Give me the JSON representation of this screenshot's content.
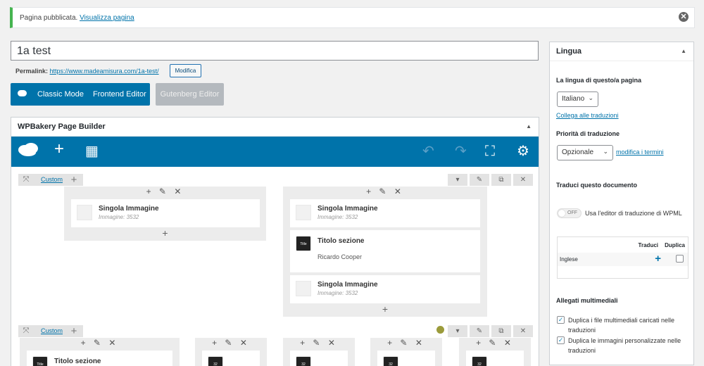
{
  "notice": {
    "text": "Pagina pubblicata.",
    "link": "Visualizza pagina",
    "close_glyph": "✕"
  },
  "title_value": "1a test",
  "permalink": {
    "label": "Permalink:",
    "url": "https://www.madeamisura.com/1a-test/",
    "edit": "Modifica"
  },
  "mode_buttons": {
    "classic": "Classic Mode",
    "frontend": "Frontend Editor",
    "gutenberg": "Gutenberg Editor"
  },
  "wpbakery": {
    "title": "WPBakery Page Builder",
    "toolbar": {
      "add": "+",
      "templates": "▦",
      "undo": "↶",
      "redo": "↷",
      "fullscreen": "⛶",
      "settings": "⚙"
    }
  },
  "builder": {
    "custom_label": "Custom",
    "col_controls": "+ ✎ ✕",
    "row1": {
      "col1": [
        {
          "name": "Singola Immagine",
          "sub": "Immagine: 3532"
        }
      ],
      "col2": [
        {
          "name": "Singola Immagine",
          "sub": "Immagine: 3532"
        },
        {
          "name": "Titolo sezione",
          "sub": "Ricardo Cooper",
          "thumb": "Title"
        },
        {
          "name": "Singola Immagine",
          "sub": "Immagine: 3532"
        }
      ]
    },
    "row2": {
      "col1_el": {
        "name": "Titolo sezione",
        "thumb": "Title"
      },
      "counter_thumb": "32"
    }
  },
  "sidebar": {
    "title": "Lingua",
    "lang_label": "La lingua di questo/a pagina",
    "lang_value": "Italiano",
    "connect_link": "Collega alle traduzioni",
    "priority_label": "Priorità di traduzione",
    "priority_value": "Opzionale",
    "priority_link": "modifica i termini",
    "translate_label": "Traduci questo documento",
    "toggle_off": "OFF",
    "toggle_text": "Usa l'editor di traduzione di WPML",
    "table": {
      "col_translate": "Traduci",
      "col_duplicate": "Duplica",
      "lang": "Inglese",
      "plus": "+"
    },
    "media_label": "Allegati multimediali",
    "media_opt1": "Duplica i file multimediali caricati nelle traduzioni",
    "media_opt2": "Duplica le immagini personalizzate nelle traduzioni"
  },
  "colors": {
    "accent": "#0073aa",
    "notice_green": "#46b450"
  }
}
